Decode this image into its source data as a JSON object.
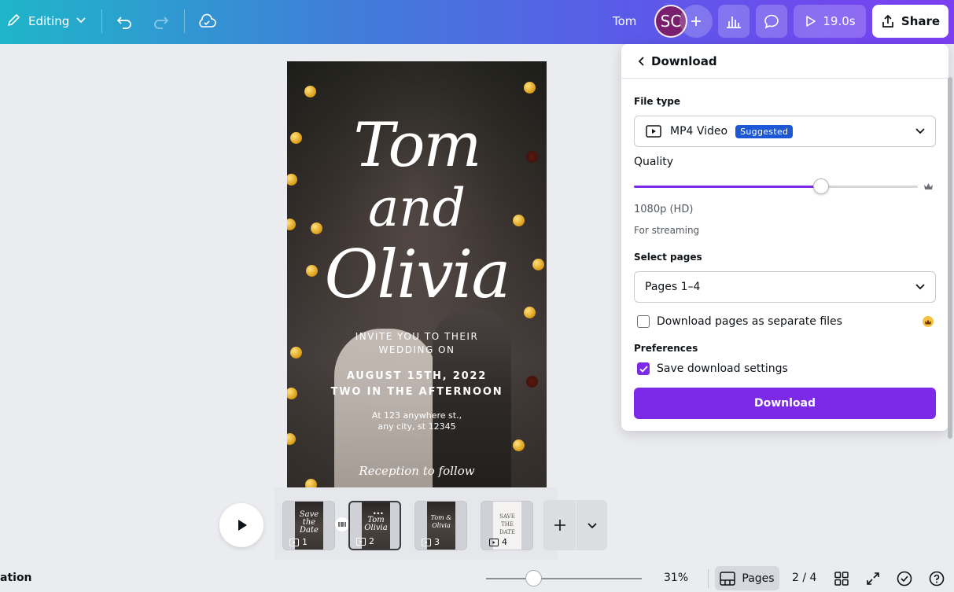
{
  "topbar": {
    "editing_label": "Editing",
    "user_name": "Tom",
    "avatar_initials": "SC",
    "timer_label": "19.0s",
    "share_label": "Share"
  },
  "design": {
    "name_line1": "Tom",
    "name_line2": "and",
    "name_line3": "Olivia",
    "invite_line1": "INVITE YOU TO THEIR",
    "invite_line2": "WEDDING ON",
    "date_line1": "AUGUST 15TH, 2022",
    "date_line2": "TWO IN THE AFTERNOON",
    "address_line1": "At 123 anywhere st.,",
    "address_line2": "any city, st 12345",
    "reception": "Reception to follow"
  },
  "panel": {
    "title": "Download",
    "file_type_label": "File type",
    "file_type_value": "MP4 Video",
    "suggested_badge": "Suggested",
    "quality_label": "Quality",
    "quality_value": "1080p (HD)",
    "quality_fraction": 0.66,
    "quality_hint": "For streaming",
    "select_pages_label": "Select pages",
    "pages_value": "Pages 1–4",
    "separate_files_label": "Download pages as separate files",
    "separate_files_checked": false,
    "preferences_label": "Preferences",
    "save_settings_label": "Save download settings",
    "save_settings_checked": true,
    "download_button": "Download"
  },
  "timeline": {
    "pages": [
      {
        "number": "1",
        "thumb_text": "Save the Date"
      },
      {
        "number": "2",
        "thumb_text": "Tom Olivia"
      },
      {
        "number": "3",
        "thumb_text": "Tom & Olivia"
      },
      {
        "number": "4",
        "thumb_text": "SAVE THE DATE"
      }
    ],
    "selected_page": 2
  },
  "bottombar": {
    "left_label": "ation",
    "zoom_value": "31%",
    "pages_label": "Pages",
    "page_counter": "2 / 4"
  },
  "colors": {
    "accent": "#7d2ae8",
    "badge": "#1c57d6",
    "avatar": "#7a1e6e"
  }
}
